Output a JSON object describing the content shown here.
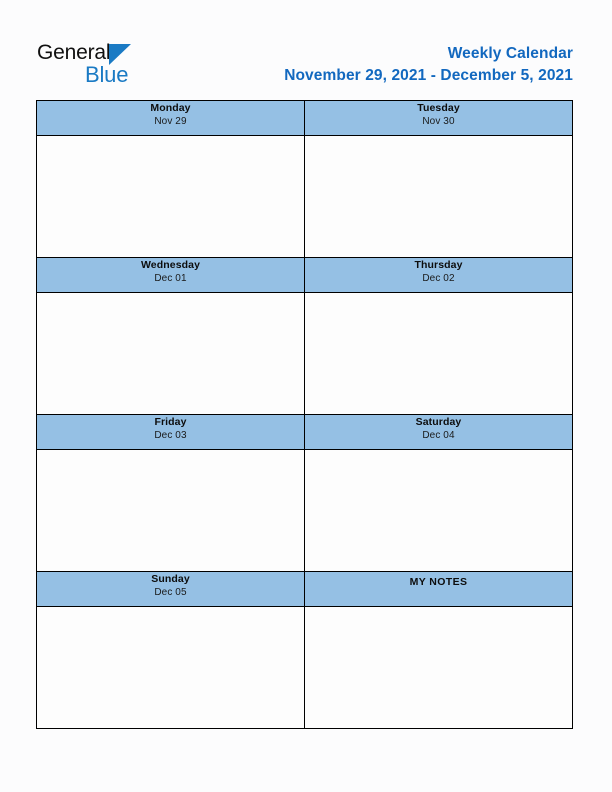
{
  "logo": {
    "word_one": "General",
    "word_two": "Blue",
    "triangle_icon": "triangle-icon",
    "dark_color": "#101010",
    "blue_color": "#1a7ac4"
  },
  "header": {
    "title": "Weekly Calendar",
    "date_range": "November 29, 2021 - December 5, 2021",
    "title_color": "#1268bf"
  },
  "theme": {
    "header_cell_bg": "#95c0e4",
    "body_cell_bg": "#fdfdfd",
    "border_color": "#000000",
    "page_bg": "#fcfcfd"
  },
  "calendar": {
    "rows": [
      {
        "cells": [
          {
            "kind": "day",
            "day_name": "Monday",
            "day_date": "Nov 29",
            "note": ""
          },
          {
            "kind": "day",
            "day_name": "Tuesday",
            "day_date": "Nov 30",
            "note": ""
          }
        ]
      },
      {
        "cells": [
          {
            "kind": "day",
            "day_name": "Wednesday",
            "day_date": "Dec 01",
            "note": ""
          },
          {
            "kind": "day",
            "day_name": "Thursday",
            "day_date": "Dec 02",
            "note": ""
          }
        ]
      },
      {
        "cells": [
          {
            "kind": "day",
            "day_name": "Friday",
            "day_date": "Dec 03",
            "note": ""
          },
          {
            "kind": "day",
            "day_name": "Saturday",
            "day_date": "Dec 04",
            "note": ""
          }
        ]
      },
      {
        "cells": [
          {
            "kind": "day",
            "day_name": "Sunday",
            "day_date": "Dec 05",
            "note": ""
          },
          {
            "kind": "notes",
            "notes_label": "MY NOTES",
            "note": ""
          }
        ]
      }
    ]
  }
}
